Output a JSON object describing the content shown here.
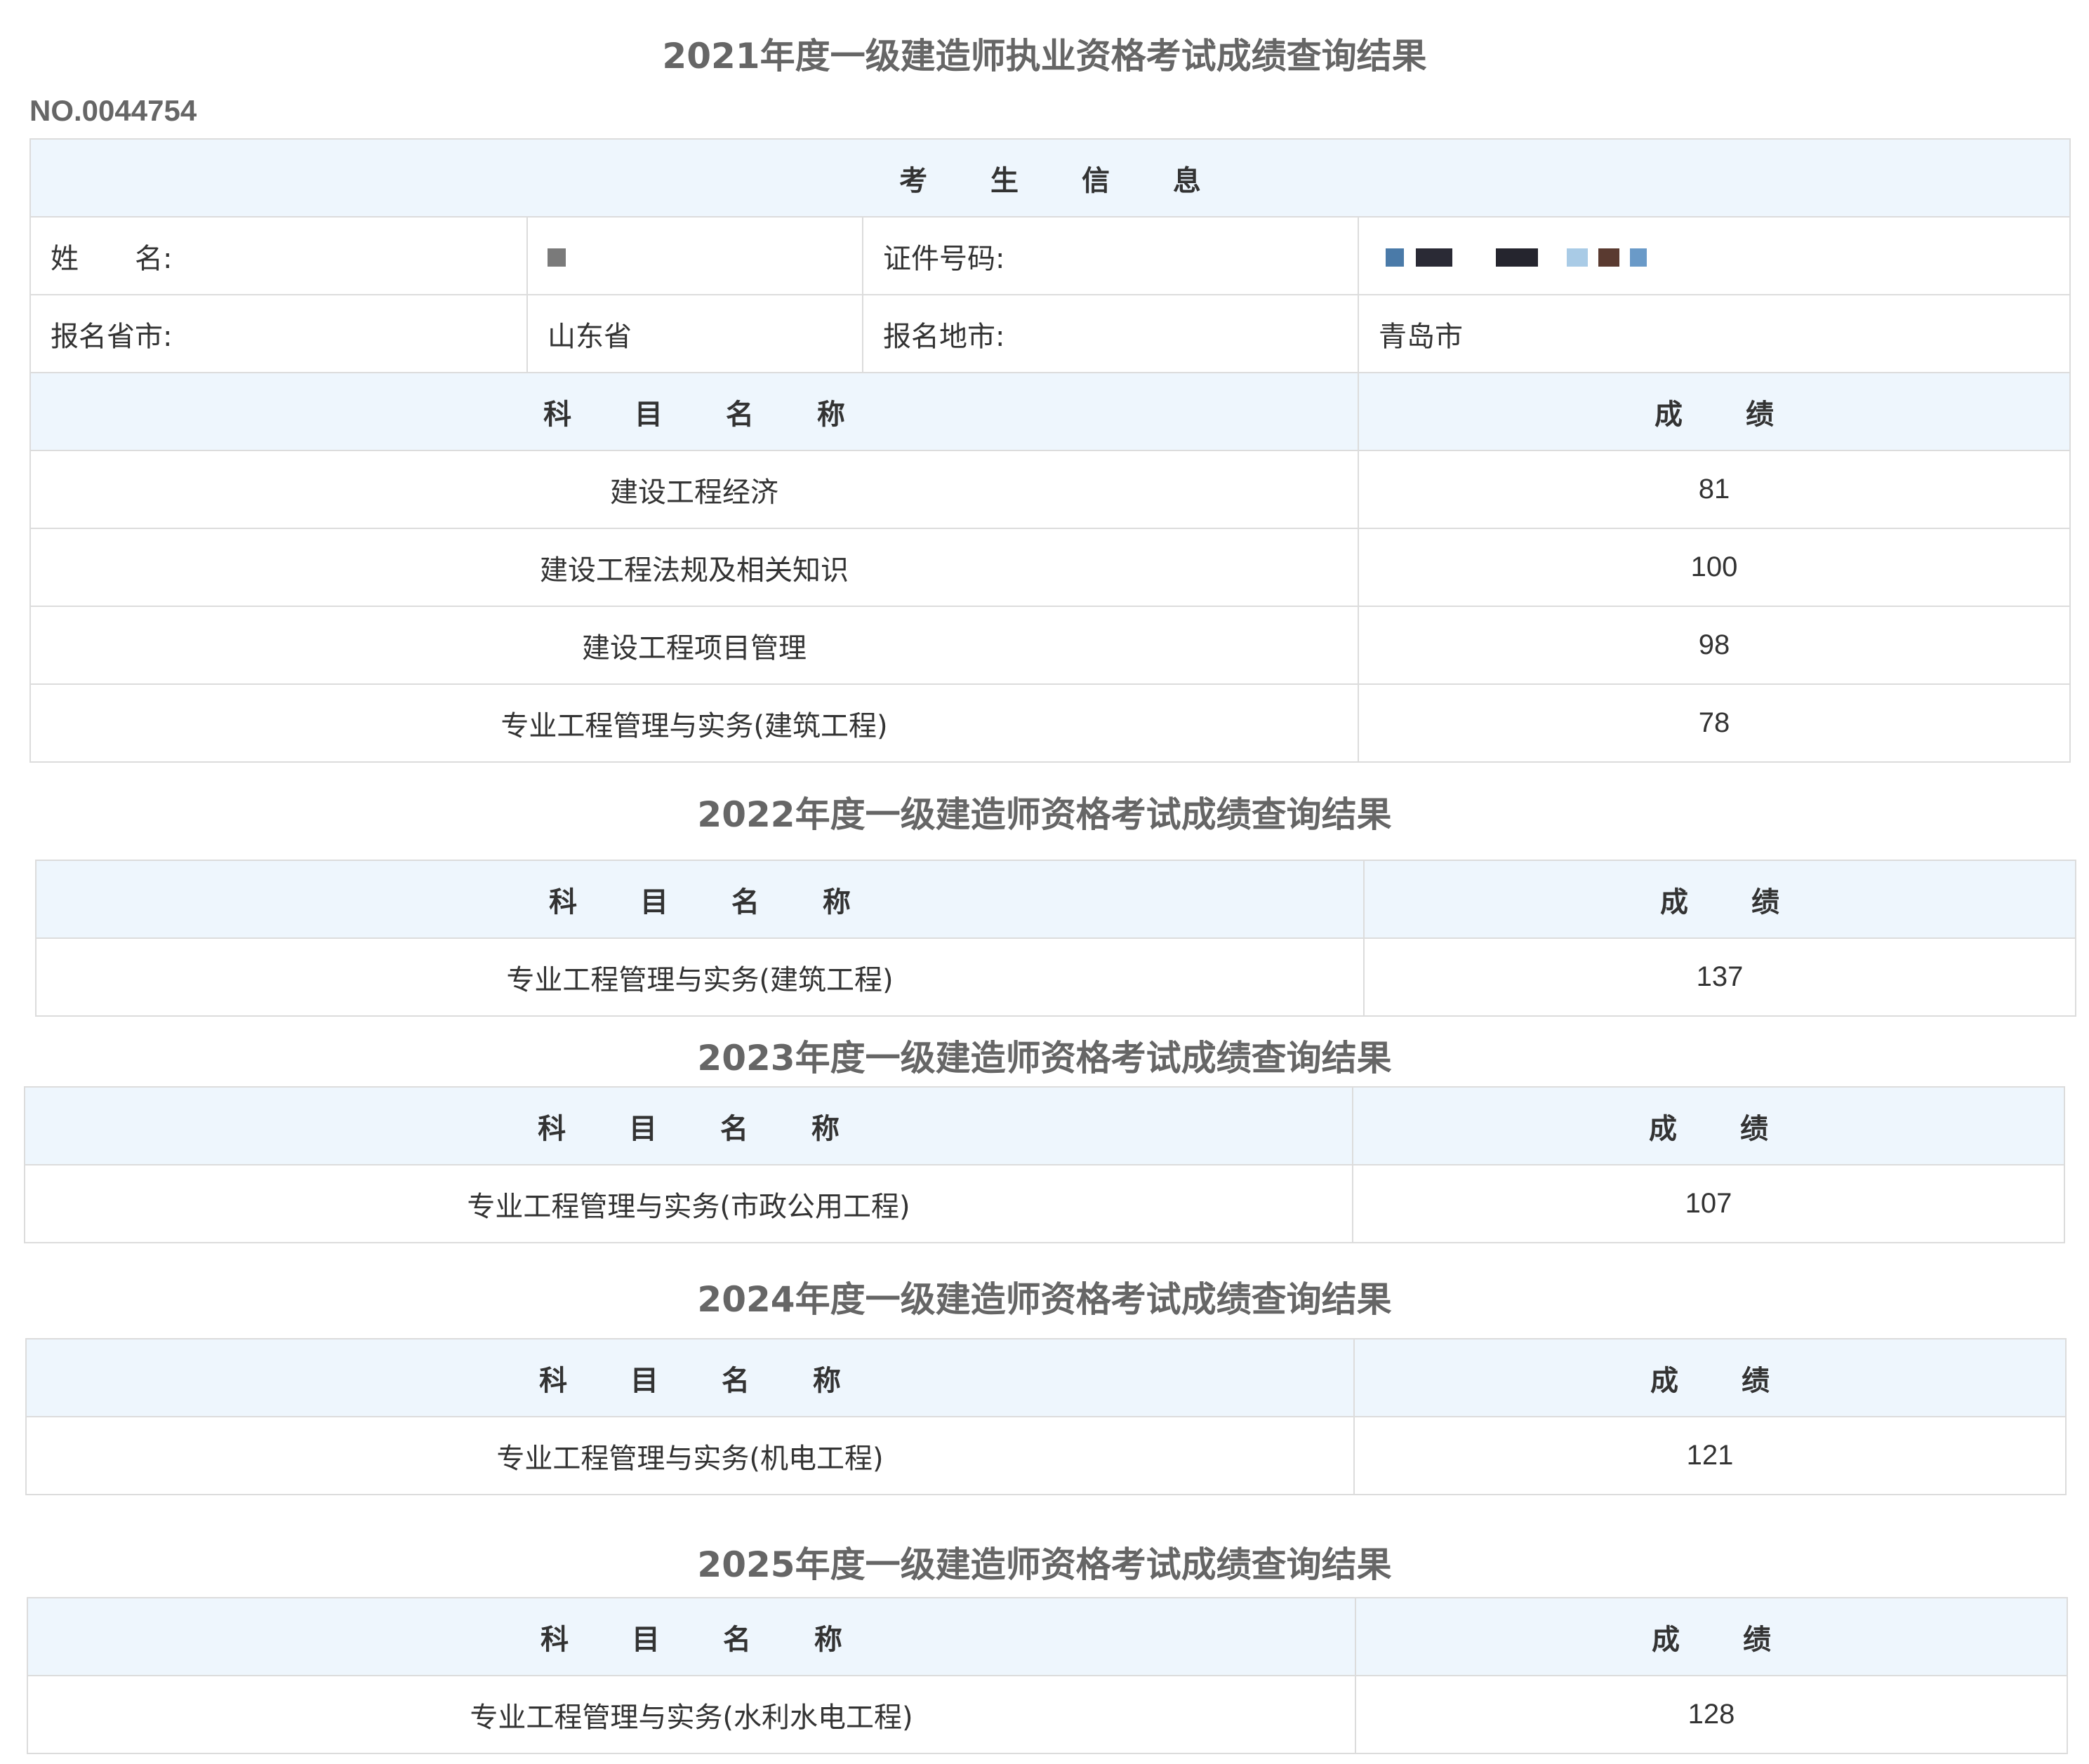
{
  "serial_no": "NO.0044754",
  "y2021": {
    "title": "2021年度一级建造师执业资格考试成绩查询结果",
    "section_header": "考 生 信 息",
    "name_label": "姓　　名:",
    "name_value": "",
    "id_label": "证件号码:",
    "id_value": "",
    "province_label": "报名省市:",
    "province_value": "山东省",
    "city_label": "报名地市:",
    "city_value": "青岛市",
    "subject_header": "科 目 名 称",
    "score_header": "成 绩",
    "rows": [
      {
        "subject": "建设工程经济",
        "score": "81"
      },
      {
        "subject": "建设工程法规及相关知识",
        "score": "100"
      },
      {
        "subject": "建设工程项目管理",
        "score": "98"
      },
      {
        "subject": "专业工程管理与实务(建筑工程)",
        "score": "78"
      }
    ]
  },
  "y2022": {
    "title": "2022年度一级建造师资格考试成绩查询结果",
    "subject_header": "科 目 名 称",
    "score_header": "成 绩",
    "rows": [
      {
        "subject": "专业工程管理与实务(建筑工程)",
        "score": "137"
      }
    ]
  },
  "y2023": {
    "title": "2023年度一级建造师资格考试成绩查询结果",
    "subject_header": "科 目 名 称",
    "score_header": "成 绩",
    "rows": [
      {
        "subject": "专业工程管理与实务(市政公用工程)",
        "score": "107"
      }
    ]
  },
  "y2024": {
    "title": "2024年度一级建造师资格考试成绩查询结果",
    "subject_header": "科 目 名 称",
    "score_header": "成 绩",
    "rows": [
      {
        "subject": "专业工程管理与实务(机电工程)",
        "score": "121"
      }
    ]
  },
  "y2025": {
    "title": "2025年度一级建造师资格考试成绩查询结果",
    "subject_header": "科 目 名 称",
    "score_header": "成 绩",
    "rows": [
      {
        "subject": "专业工程管理与实务(水利水电工程)",
        "score": "128"
      }
    ]
  },
  "colors": {
    "header_bg": "#eef6fd",
    "border": "#dcdcdc",
    "title_text": "#666666",
    "body_text": "#333333"
  }
}
